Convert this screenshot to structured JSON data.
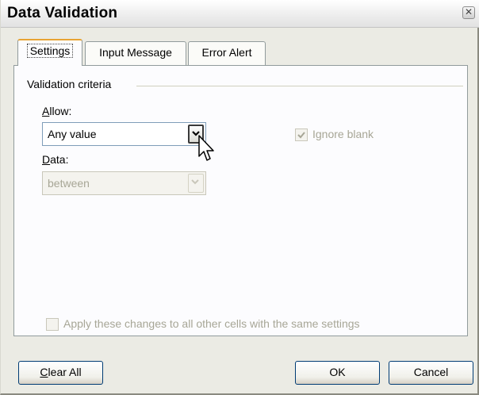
{
  "window": {
    "title": "Data Validation"
  },
  "tabs": [
    {
      "label": "Settings",
      "active": true
    },
    {
      "label": "Input Message",
      "active": false
    },
    {
      "label": "Error Alert",
      "active": false
    }
  ],
  "settings": {
    "section_title": "Validation criteria",
    "allow": {
      "label": "Allow:",
      "mnemonic": "A",
      "value": "Any value"
    },
    "data": {
      "label": "Data:",
      "mnemonic": "D",
      "value": "between",
      "enabled": false
    },
    "ignore_blank": {
      "label": "Ignore blank",
      "checked": true,
      "enabled": false
    },
    "apply_all": {
      "label": "Apply these changes to all other cells with the same settings",
      "checked": false,
      "enabled": false
    }
  },
  "buttons": {
    "clear_all": "Clear All",
    "ok": "OK",
    "cancel": "Cancel"
  },
  "icons": {
    "close": "close-icon",
    "dropdown": "chevron-down-icon",
    "check": "checkmark-icon",
    "cursor": "mouse-pointer-icon"
  },
  "colors": {
    "dialog_background": "#ebebe4",
    "panel_background": "#fcfcfe",
    "active_tab_accent": "#e8a434",
    "disabled_text": "#a7a696",
    "button_border": "#003c74"
  }
}
